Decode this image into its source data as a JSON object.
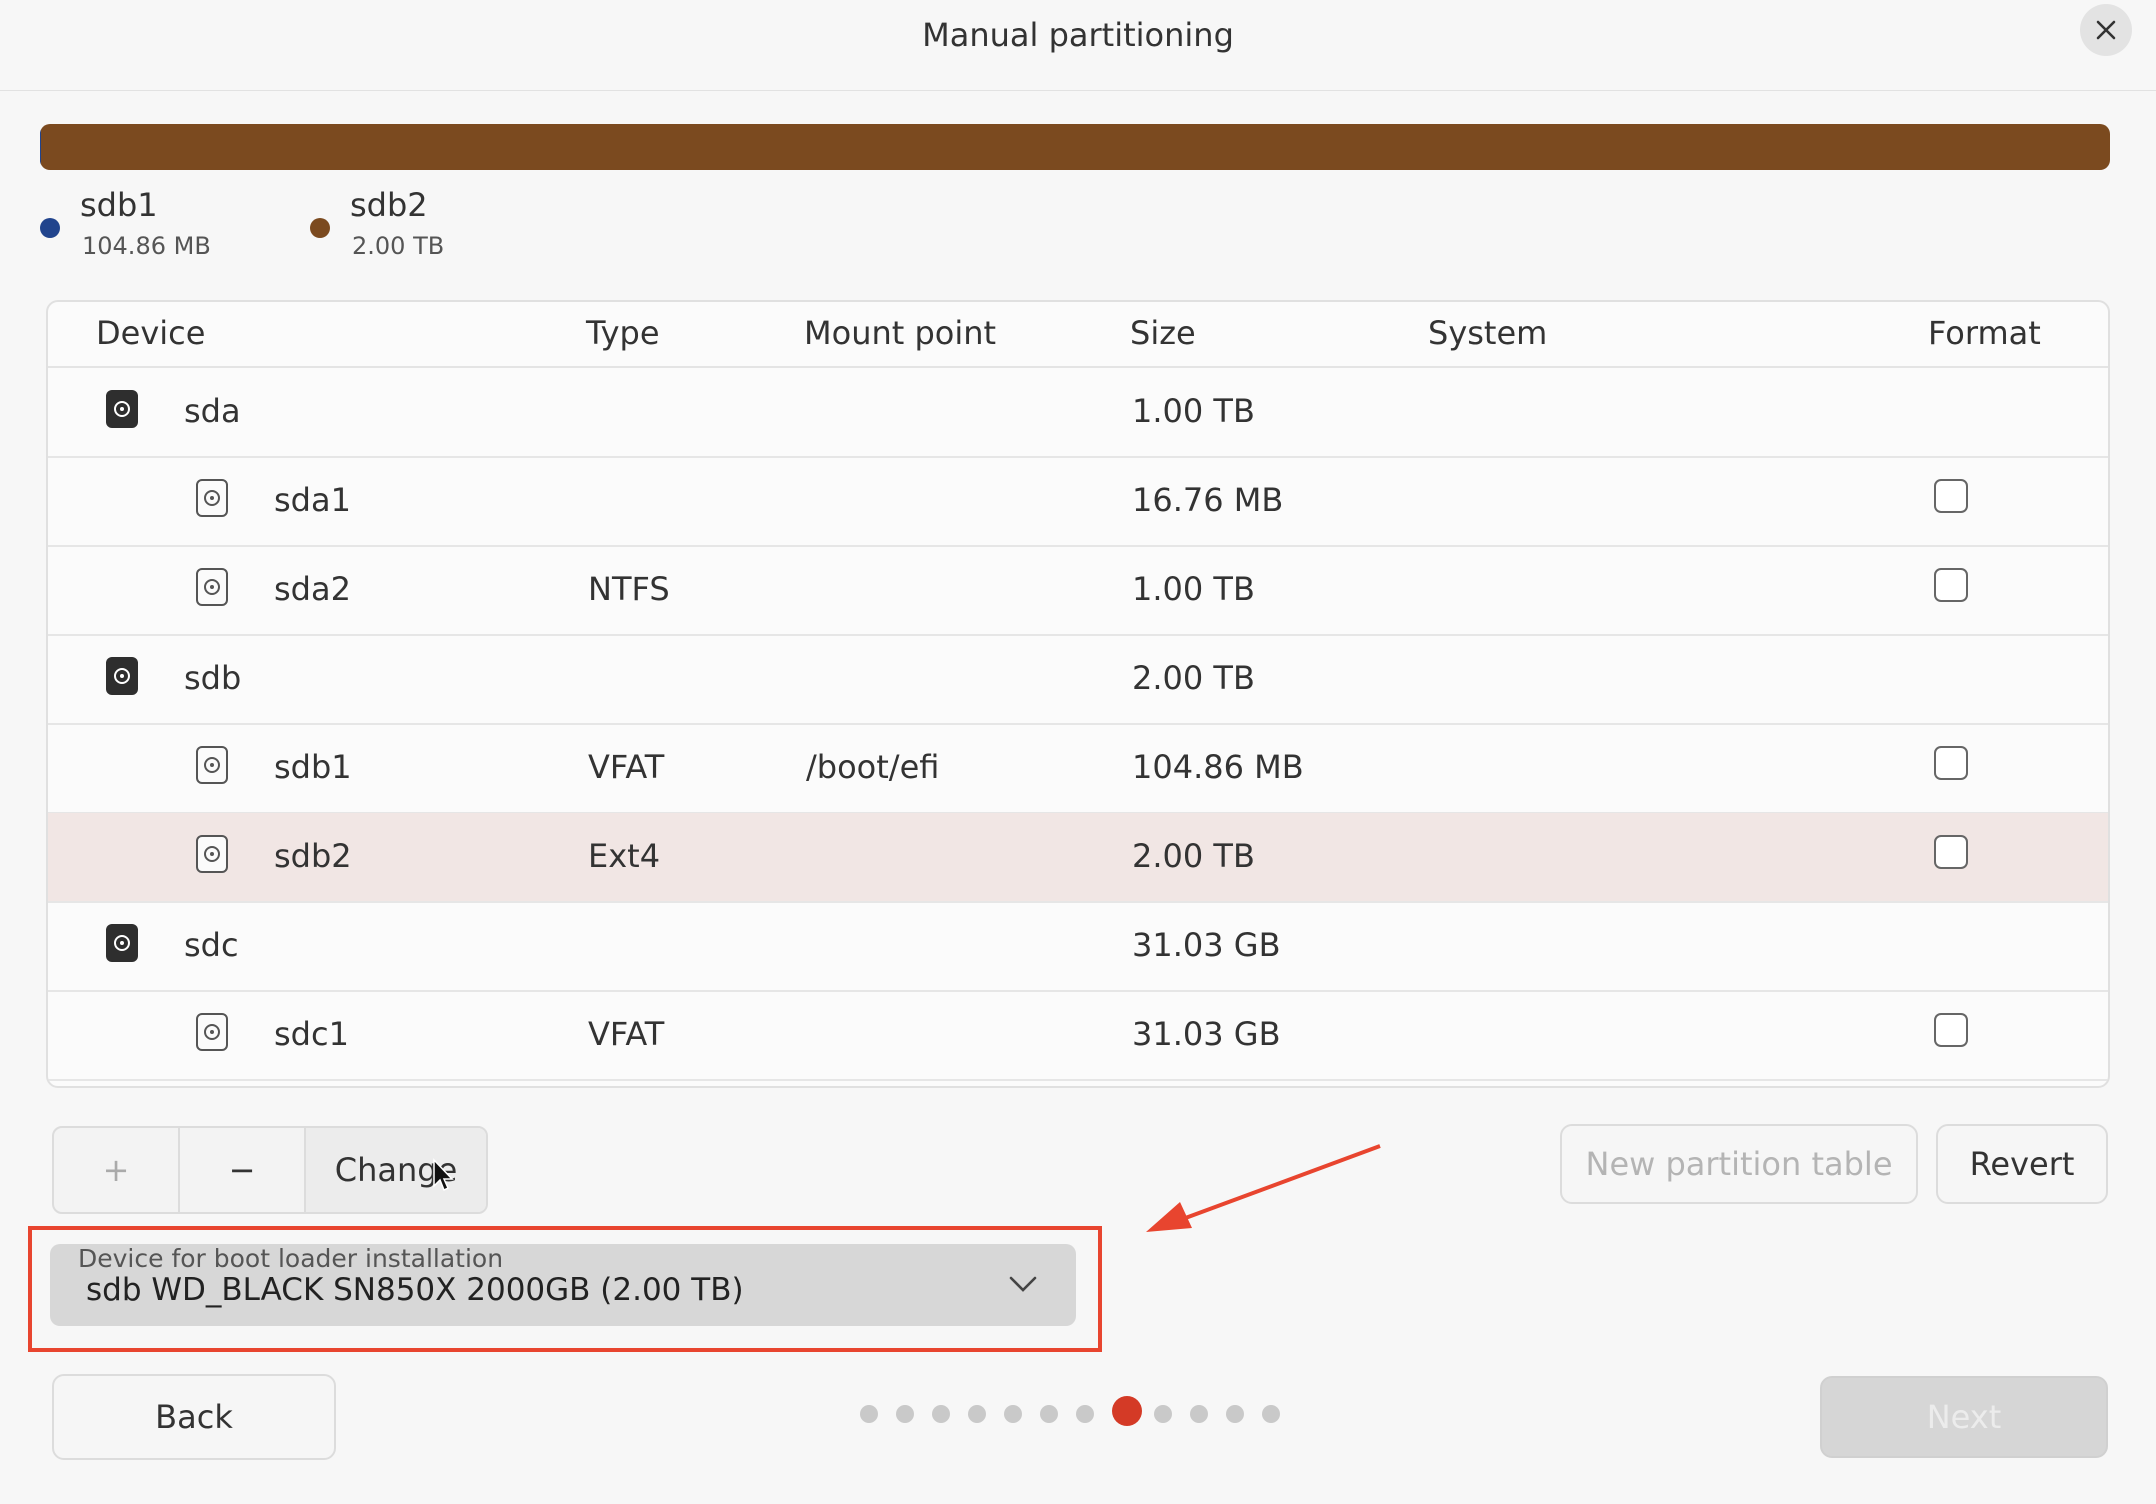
{
  "window": {
    "title": "Manual partitioning",
    "close_icon": "close-icon"
  },
  "usage": {
    "segments": [
      {
        "name": "sdb1",
        "size": "104.86 MB",
        "color": "#21448d",
        "fraction": 0.0001
      },
      {
        "name": "sdb2",
        "size": "2.00 TB",
        "color": "#7b4a1f",
        "fraction": 0.9999
      }
    ]
  },
  "table": {
    "headers": {
      "device": "Device",
      "type": "Type",
      "mount": "Mount point",
      "size": "Size",
      "system": "System",
      "format": "Format"
    },
    "rows": [
      {
        "device": "sda",
        "kind": "drive",
        "type": "",
        "mount": "",
        "size": "1.00 TB",
        "has_format": false
      },
      {
        "device": "sda1",
        "kind": "partition",
        "type": "",
        "mount": "",
        "size": "16.76 MB",
        "has_format": true
      },
      {
        "device": "sda2",
        "kind": "partition",
        "type": "NTFS",
        "mount": "",
        "size": "1.00 TB",
        "has_format": true
      },
      {
        "device": "sdb",
        "kind": "drive",
        "type": "",
        "mount": "",
        "size": "2.00 TB",
        "has_format": false
      },
      {
        "device": "sdb1",
        "kind": "partition",
        "type": "VFAT",
        "mount": "/boot/efi",
        "size": "104.86 MB",
        "has_format": true
      },
      {
        "device": "sdb2",
        "kind": "partition",
        "type": "Ext4",
        "mount": "",
        "size": "2.00 TB",
        "has_format": true,
        "selected": true
      },
      {
        "device": "sdc",
        "kind": "drive",
        "type": "",
        "mount": "",
        "size": "31.03 GB",
        "has_format": false
      },
      {
        "device": "sdc1",
        "kind": "partition",
        "type": "VFAT",
        "mount": "",
        "size": "31.03 GB",
        "has_format": true
      }
    ]
  },
  "toolbar": {
    "add_label": "+",
    "remove_label": "−",
    "change_label": "Change",
    "new_table_label": "New partition table",
    "revert_label": "Revert"
  },
  "bootloader": {
    "label": "Device for boot loader installation",
    "value": "sdb WD_BLACK SN850X 2000GB (2.00 TB)"
  },
  "footer": {
    "back_label": "Back",
    "next_label": "Next",
    "pages_total": 12,
    "page_current": 8
  },
  "colors": {
    "accent": "#d43a26",
    "highlight": "#e8452f"
  }
}
